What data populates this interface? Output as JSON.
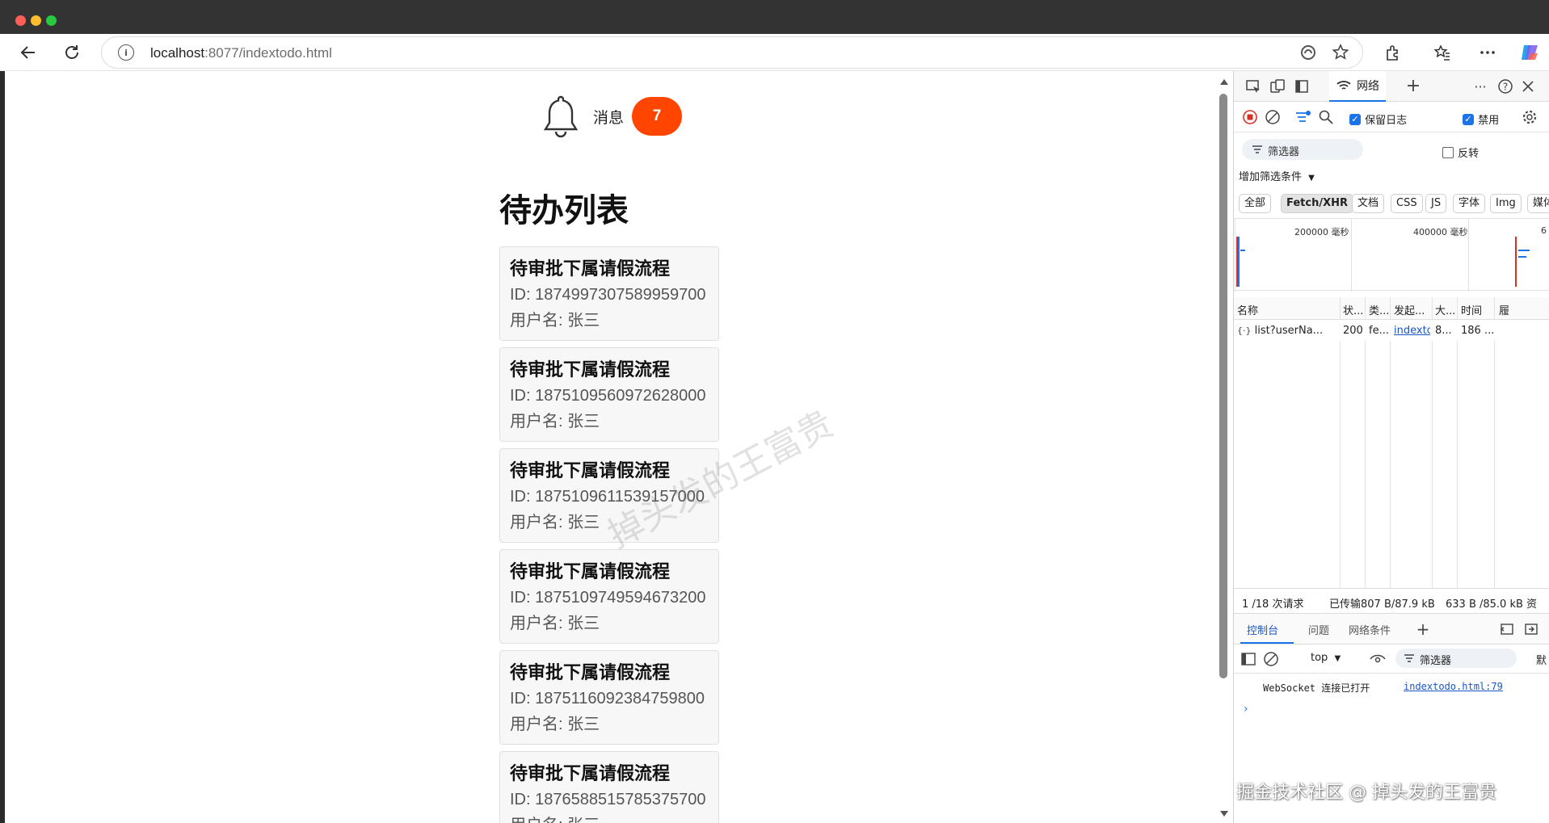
{
  "browser": {
    "url_host": "localhost",
    "url_rest": ":8077/indextodo.html"
  },
  "page": {
    "notify_label": "消息",
    "notify_count": "7",
    "title": "待办列表",
    "todos": [
      {
        "title": "待审批下属请假流程",
        "id": "ID: 1874997307589959700",
        "user": "用户名: 张三"
      },
      {
        "title": "待审批下属请假流程",
        "id": "ID: 1875109560972628000",
        "user": "用户名: 张三"
      },
      {
        "title": "待审批下属请假流程",
        "id": "ID: 1875109611539157000",
        "user": "用户名: 张三"
      },
      {
        "title": "待审批下属请假流程",
        "id": "ID: 1875109749594673200",
        "user": "用户名: 张三"
      },
      {
        "title": "待审批下属请假流程",
        "id": "ID: 1875116092384759800",
        "user": "用户名: 张三"
      },
      {
        "title": "待审批下属请假流程",
        "id": "ID: 1876588515785375700",
        "user": "用户名: 张三"
      }
    ],
    "watermark": "掉头发的王富贵"
  },
  "devtools": {
    "network_tab": "网络",
    "preserve_log": "保留日志",
    "disable_cache": "禁用",
    "filter_placeholder": "筛选器",
    "invert": "反转",
    "add_filter": "增加筛选条件",
    "types": [
      "全部",
      "Fetch/XHR",
      "文档",
      "CSS",
      "JS",
      "字体",
      "Img",
      "媒体"
    ],
    "overview_labels": [
      "200000 毫秒",
      "400000 毫秒",
      "6"
    ],
    "columns": [
      "名称",
      "状...",
      "类...",
      "发起...",
      "大...",
      "时间",
      "履"
    ],
    "row": {
      "name": "list?userNa...",
      "status": "200",
      "type": "fe...",
      "initiator": "indextod",
      "size": "8...",
      "time": "186 ..."
    },
    "status_requests": "1 /18 次请求",
    "status_transferred": "已传输807 B/87.9 kB",
    "status_resources": "633 B /85.0 kB 资",
    "console_tabs": [
      "控制台",
      "问题",
      "网络条件"
    ],
    "console_context": "top",
    "console_filter": "筛选器",
    "console_default": "默",
    "console_message": "WebSocket 连接已打开",
    "console_source": "indextodo.html:79"
  },
  "footer_watermark": "掘金技术社区 @ 掉头发的王富贵",
  "colors": {
    "badge": "#ff4500",
    "accent": "#1a73e8"
  }
}
